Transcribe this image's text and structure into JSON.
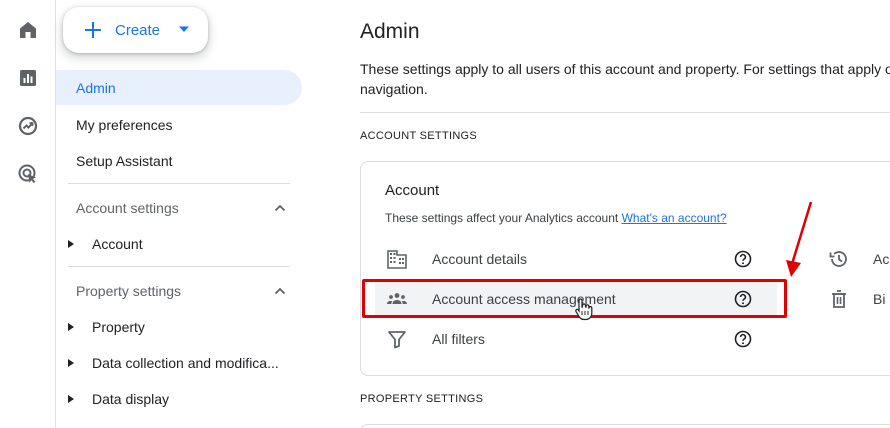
{
  "rail": {
    "icons": [
      "home-icon",
      "reports-icon",
      "explore-icon",
      "advertising-icon"
    ]
  },
  "create": {
    "label": "Create"
  },
  "nav": {
    "admin": "Admin",
    "my_preferences": "My preferences",
    "setup_assistant": "Setup Assistant",
    "account_settings": "Account settings",
    "account": "Account",
    "property_settings": "Property settings",
    "property": "Property",
    "data_collection": "Data collection and modifica...",
    "data_display": "Data display"
  },
  "main": {
    "title": "Admin",
    "description": "These settings apply to all users of this account and property. For settings that apply o navigation.",
    "description_line1": "These settings apply to all users of this account and property. For settings that apply o",
    "description_line2": "navigation.",
    "account_settings_label": "ACCOUNT SETTINGS",
    "property_settings_label": "PROPERTY SETTINGS"
  },
  "account_card": {
    "title": "Account",
    "subtitle": "These settings affect your Analytics account",
    "link": "What's an account?",
    "rows": [
      {
        "label": "Account details",
        "icon": "building-icon"
      },
      {
        "label": "Account access management",
        "icon": "people-icon"
      },
      {
        "label": "All filters",
        "icon": "filter-icon"
      }
    ],
    "right_rows": [
      {
        "label": "Ac",
        "icon": "history-icon"
      },
      {
        "label": "Bi",
        "icon": "trash-icon"
      }
    ]
  },
  "colors": {
    "accent": "#1a73e8",
    "annotation": "#e00000",
    "active_bg": "#e8f0fe"
  }
}
